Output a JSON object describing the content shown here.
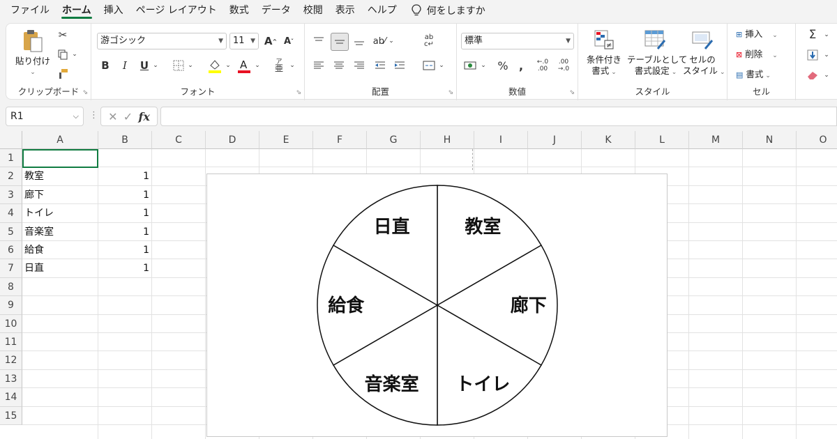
{
  "menu": {
    "tabs": [
      "ファイル",
      "ホーム",
      "挿入",
      "ページ レイアウト",
      "数式",
      "データ",
      "校閲",
      "表示",
      "ヘルプ"
    ],
    "active_tab": "ホーム",
    "search_label": "何をしますか"
  },
  "ribbon": {
    "clipboard": {
      "label": "クリップボード",
      "paste_label": "貼り付け"
    },
    "font": {
      "label": "フォント",
      "font_name": "游ゴシック",
      "font_size": "11"
    },
    "alignment": {
      "label": "配置"
    },
    "number": {
      "label": "数値",
      "format": "標準"
    },
    "styles": {
      "label": "スタイル",
      "conditional_line1": "条件付き",
      "conditional_line2": "書式",
      "table_line1": "テーブルとして",
      "table_line2": "書式設定",
      "cell_line1": "セルの",
      "cell_line2": "スタイル"
    },
    "cells": {
      "label": "セル",
      "insert": "挿入",
      "delete": "削除",
      "format": "書式"
    },
    "colors": {
      "accent": "#107c41",
      "font_color": "#e81123",
      "highlight": "#ffff00"
    }
  },
  "formula_bar": {
    "name_box": "R1",
    "formula": ""
  },
  "sheet": {
    "columns": [
      "A",
      "B",
      "C",
      "D",
      "E",
      "F",
      "G",
      "H",
      "I",
      "J",
      "K",
      "L",
      "M",
      "N",
      "O"
    ],
    "rows": [
      "1",
      "2",
      "3",
      "4",
      "5",
      "6",
      "7",
      "8",
      "9",
      "10",
      "11",
      "12",
      "13",
      "14",
      "15"
    ],
    "data": [
      {
        "a": "教室",
        "b": "1"
      },
      {
        "a": "廊下",
        "b": "1"
      },
      {
        "a": "トイレ",
        "b": "1"
      },
      {
        "a": "音楽室",
        "b": "1"
      },
      {
        "a": "給食",
        "b": "1"
      },
      {
        "a": "日直",
        "b": "1"
      }
    ]
  },
  "chart_data": {
    "type": "pie",
    "categories": [
      "教室",
      "廊下",
      "トイレ",
      "音楽室",
      "給食",
      "日直"
    ],
    "values": [
      1,
      1,
      1,
      1,
      1,
      1
    ]
  }
}
